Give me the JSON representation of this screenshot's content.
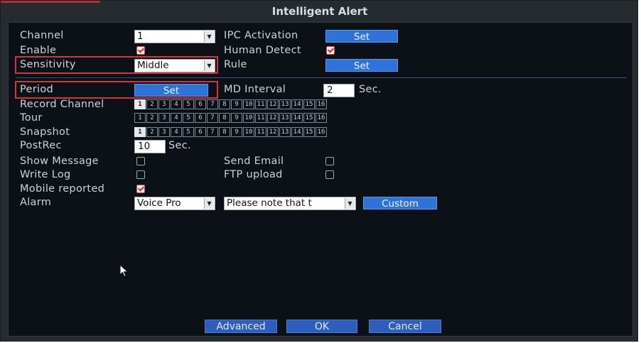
{
  "window": {
    "title": "Intelligent Alert"
  },
  "form": {
    "channel": {
      "label": "Channel",
      "value": "1"
    },
    "ipc_activation": {
      "label": "IPC Activation",
      "button": "Set"
    },
    "enable": {
      "label": "Enable",
      "checked": true
    },
    "human_detect": {
      "label": "Human Detect",
      "checked": true
    },
    "sensitivity": {
      "label": "Sensitivity",
      "value": "Middle"
    },
    "rule": {
      "label": "Rule",
      "button": "Set"
    },
    "period": {
      "label": "Period",
      "button": "Set"
    },
    "md_interval": {
      "label": "MD Interval",
      "value": "2",
      "unit": "Sec."
    },
    "record_channel": {
      "label": "Record Channel",
      "selected": [
        1
      ]
    },
    "tour": {
      "label": "Tour",
      "selected": []
    },
    "snapshot": {
      "label": "Snapshot",
      "selected": [
        1
      ]
    },
    "channel_numbers": [
      "1",
      "2",
      "3",
      "4",
      "5",
      "6",
      "7",
      "8",
      "9",
      "10",
      "11",
      "12",
      "13",
      "14",
      "15",
      "16"
    ],
    "postrec": {
      "label": "PostRec",
      "value": "10",
      "unit": "Sec."
    },
    "show_message": {
      "label": "Show Message",
      "checked": false
    },
    "send_email": {
      "label": "Send Email",
      "checked": false
    },
    "write_log": {
      "label": "Write Log",
      "checked": false
    },
    "ftp_upload": {
      "label": "FTP upload",
      "checked": false
    },
    "mobile_reported": {
      "label": "Mobile reported",
      "checked": true
    },
    "alarm": {
      "label": "Alarm",
      "value": "Voice Pro",
      "message": "Please note that t",
      "custom_button": "Custom"
    }
  },
  "footer": {
    "advanced": "Advanced",
    "ok": "OK",
    "cancel": "Cancel"
  },
  "colors": {
    "accent_button": "#2e73d8",
    "footer_button": "#2d5dbd",
    "highlight": "#d8323b",
    "panel": "#0c1117"
  }
}
